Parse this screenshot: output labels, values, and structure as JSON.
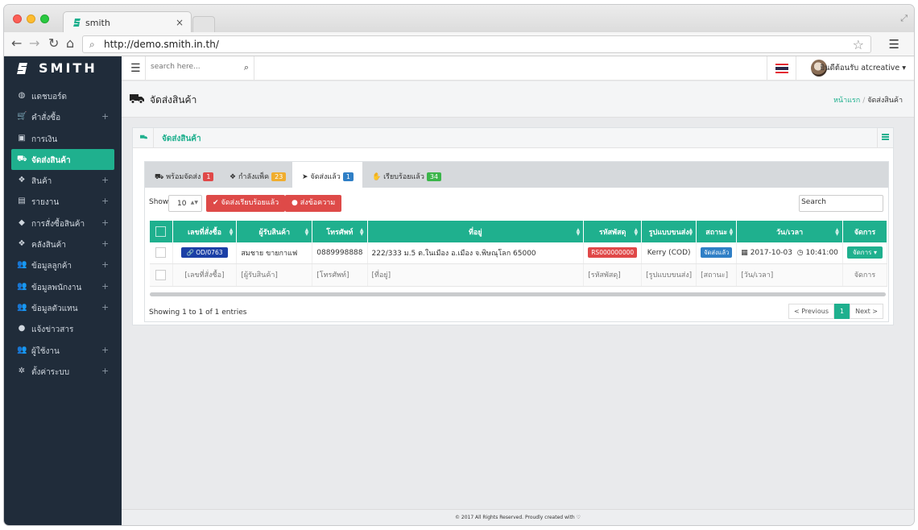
{
  "browser": {
    "tab_title": "smith",
    "tab_close": "×",
    "url": "http://demo.smith.in.th/"
  },
  "app": {
    "brand": "SMITH",
    "search_placeholder": "search here...",
    "user_greeting": "ยินดีต้อนรับ atcreative"
  },
  "sidebar": {
    "items": [
      {
        "label": "แดชบอร์ด",
        "icon": "dashboard-icon",
        "glyph": "◍",
        "has_sub": false
      },
      {
        "label": "คำสั่งซื้อ",
        "icon": "cart-icon",
        "glyph": "🛒",
        "has_sub": true
      },
      {
        "label": "การเงิน",
        "icon": "money-icon",
        "glyph": "▣",
        "has_sub": false
      },
      {
        "label": "จัดส่งสินค้า",
        "icon": "truck-icon",
        "glyph": "⛟",
        "has_sub": false,
        "active": true
      },
      {
        "label": "สินค้า",
        "icon": "cubes-icon",
        "glyph": "❖",
        "has_sub": true
      },
      {
        "label": "รายงาน",
        "icon": "chart-icon",
        "glyph": "▤",
        "has_sub": true
      },
      {
        "label": "การสั่งซื้อสินค้า",
        "icon": "tag-icon",
        "glyph": "◆",
        "has_sub": true
      },
      {
        "label": "คลังสินค้า",
        "icon": "cubes-icon",
        "glyph": "❖",
        "has_sub": true
      },
      {
        "label": "ข้อมูลลูกค้า",
        "icon": "users-icon",
        "glyph": "👥",
        "has_sub": true
      },
      {
        "label": "ข้อมูลพนักงาน",
        "icon": "users-icon",
        "glyph": "👥",
        "has_sub": true
      },
      {
        "label": "ข้อมูลตัวแทน",
        "icon": "users-icon",
        "glyph": "👥",
        "has_sub": true
      },
      {
        "label": "แจ้งข่าวสาร",
        "icon": "info-icon",
        "glyph": "●",
        "has_sub": false
      },
      {
        "label": "ผู้ใช้งาน",
        "icon": "users-icon",
        "glyph": "👥",
        "has_sub": true
      },
      {
        "label": "ตั้งค่าระบบ",
        "icon": "gear-icon",
        "glyph": "✲",
        "has_sub": true
      }
    ],
    "plus": "+"
  },
  "page": {
    "title": "จัดส่งสินค้า",
    "breadcrumb_home": "หน้าแรก",
    "breadcrumb_sep": "/",
    "breadcrumb_current": "จัดส่งสินค้า"
  },
  "panel": {
    "title": "จัดส่งสินค้า",
    "tabs": [
      {
        "label": "พร้อมจัดส่ง",
        "count": "1",
        "color": "#e04848",
        "icon": "truck-icon",
        "glyph": "⛟"
      },
      {
        "label": "กำลังแพ็ค",
        "count": "23",
        "color": "#f0ad2e",
        "icon": "dropbox-icon",
        "glyph": "❖"
      },
      {
        "label": "จัดส่งแล้ว",
        "count": "1",
        "color": "#2f7fc6",
        "icon": "send-icon",
        "glyph": "➤",
        "active": true
      },
      {
        "label": "เรียบร้อยแล้ว",
        "count": "34",
        "color": "#3bb54a",
        "icon": "thumbs-up-icon",
        "glyph": "✋"
      }
    ],
    "show_label": "Show",
    "page_size": "10",
    "btn_done": "จัดส่งเรียบร้อยแล้ว",
    "btn_message": "ส่งข้อความ",
    "search_label": "Search",
    "columns": [
      "เลขที่สั่งซื้อ",
      "ผู้รับสินค้า",
      "โทรศัพท์",
      "ที่อยู่",
      "รหัสพัสดุ",
      "รูปแบบขนส่ง",
      "สถานะ",
      "วัน/เวลา",
      "จัดการ"
    ],
    "rows": [
      {
        "order": "OD/0763",
        "receiver": "สมชาย ขายกาแฟ",
        "phone": "0889998888",
        "address": "222/333 ม.5 ต.ในเมือง อ.เมือง จ.พิษณุโลก 65000",
        "tracking": "RS000000000",
        "shipping": "Kerry (COD)",
        "status": "จัดส่งแล้ว",
        "date": "2017-10-03",
        "time": "10:41:00",
        "action": "จัดการ"
      }
    ],
    "filters": [
      "[เลขที่สั่งซื้อ]",
      "[ผู้รับสินค้า]",
      "[โทรศัพท์]",
      "[ที่อยู่]",
      "[รหัสพัสดุ]",
      "[รูปแบบขนส่ง]",
      "[สถานะ]",
      "[วัน/เวลา]",
      "จัดการ"
    ],
    "info": "Showing 1 to 1 of 1 entries",
    "prev": "< Previous",
    "page": "1",
    "next": "Next >"
  },
  "footer": "© 2017 All Rights Reserved. Proudly created with ♡"
}
